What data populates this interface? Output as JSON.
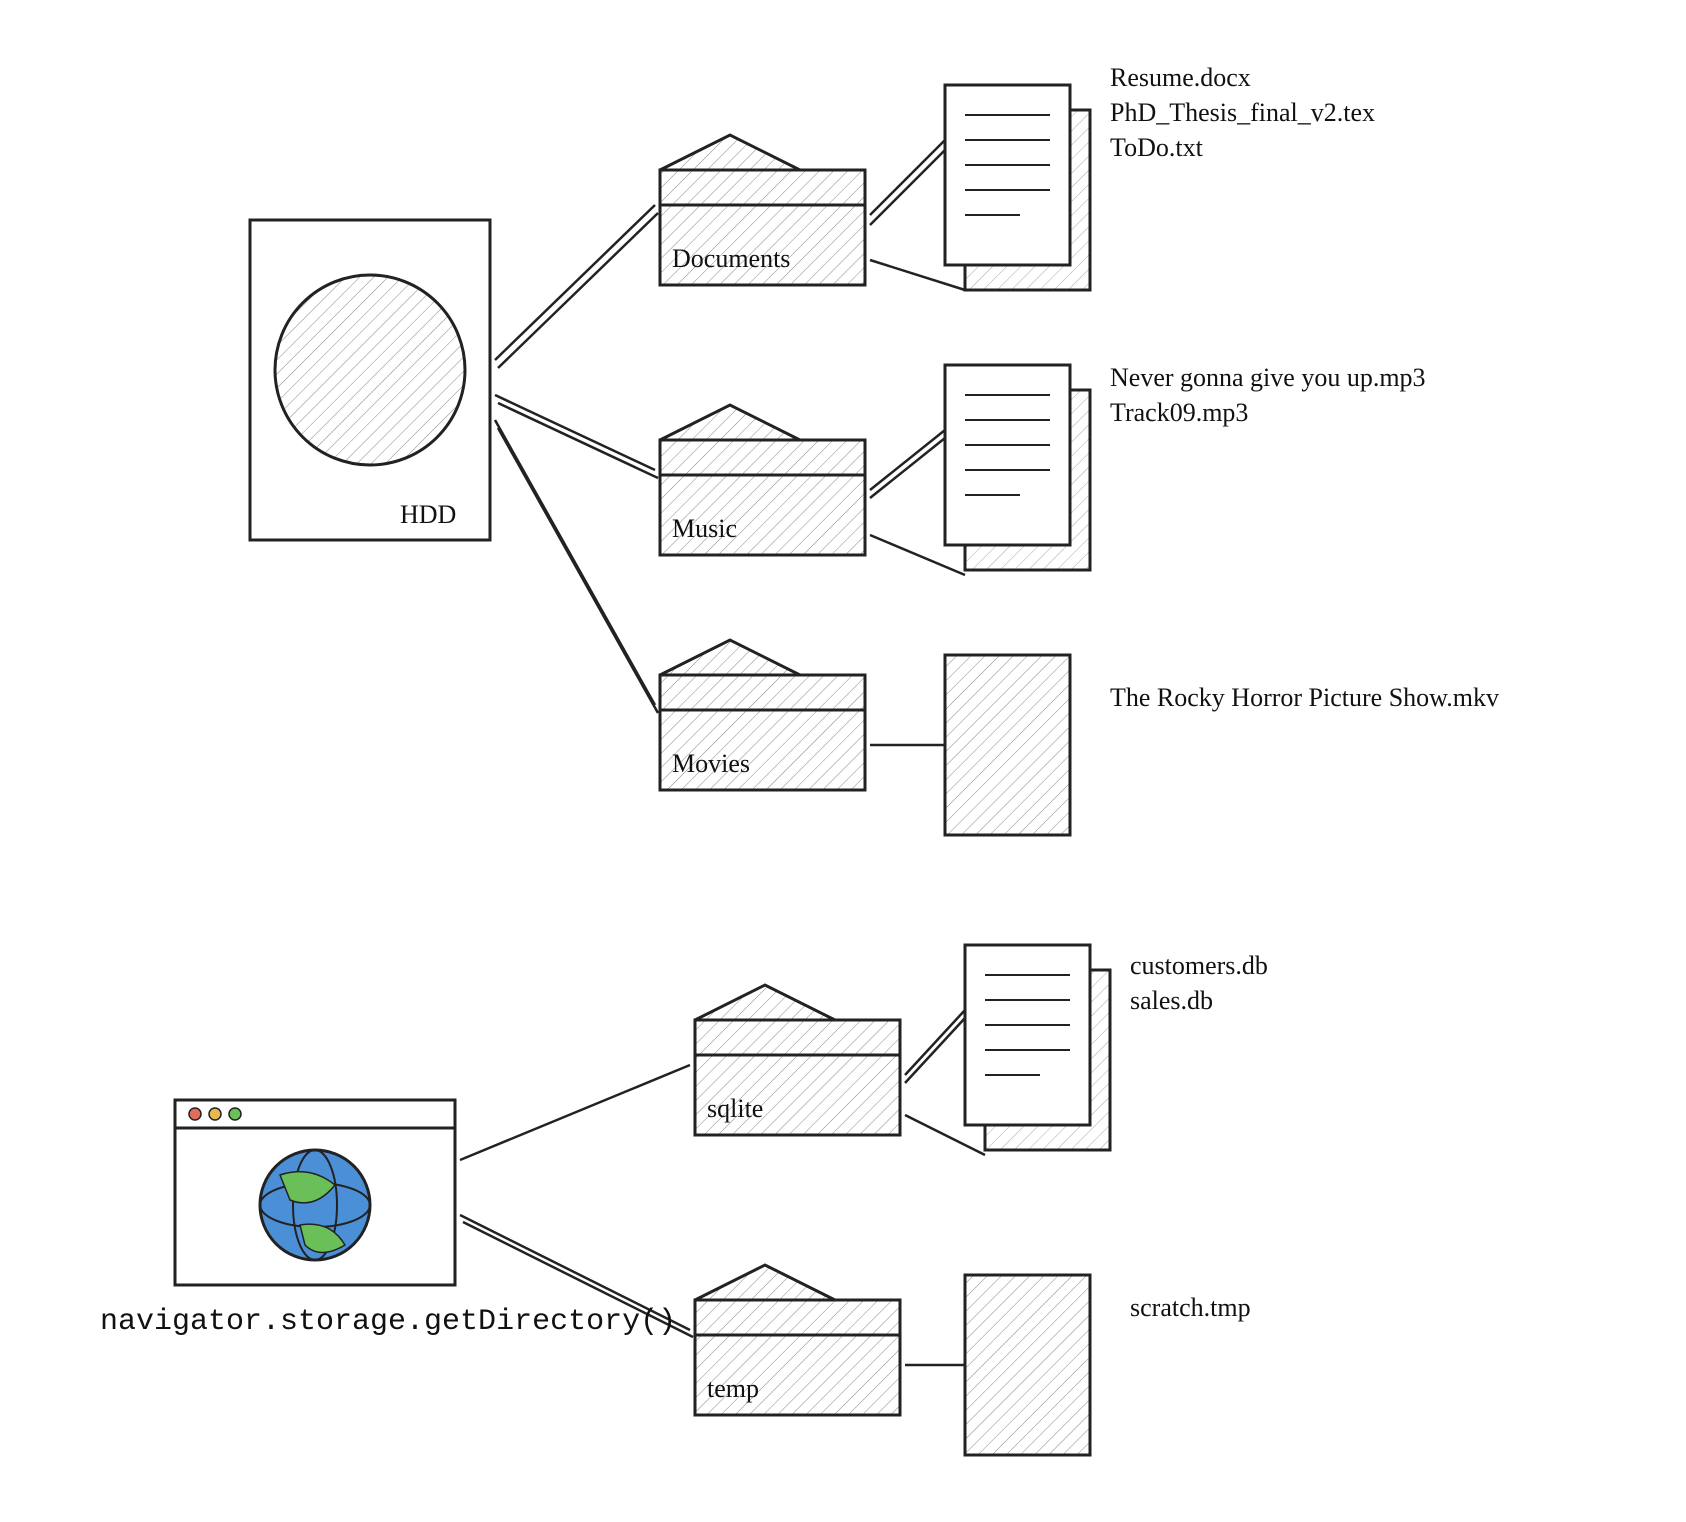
{
  "hdd": {
    "label": "HDD",
    "folders": [
      {
        "name": "Documents",
        "files": [
          "Resume.docx",
          "PhD_Thesis_final_v2.tex",
          "ToDo.txt"
        ]
      },
      {
        "name": "Music",
        "files": [
          "Never gonna give you up.mp3",
          "Track09.mp3"
        ]
      },
      {
        "name": "Movies",
        "files": [
          "The Rocky Horror Picture Show.mkv"
        ]
      }
    ]
  },
  "browser": {
    "api_call": "navigator.storage.getDirectory()",
    "folders": [
      {
        "name": "sqlite",
        "files": [
          "customers.db",
          "sales.db"
        ]
      },
      {
        "name": "temp",
        "files": [
          "scratch.tmp"
        ]
      }
    ]
  }
}
